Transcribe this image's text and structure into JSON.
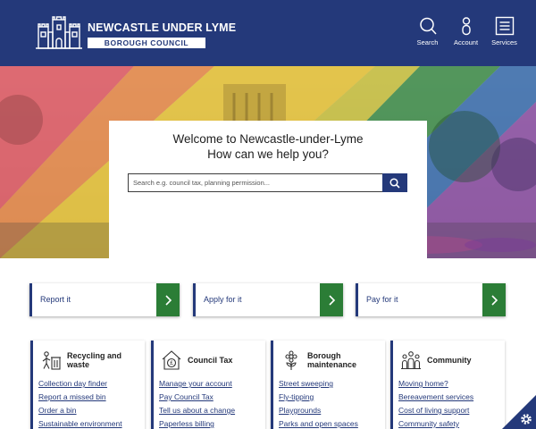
{
  "header": {
    "logo_title": "NEWCASTLE UNDER LYME",
    "logo_subtitle": "BOROUGH COUNCIL",
    "nav": [
      {
        "label": "Search",
        "icon": "search-icon"
      },
      {
        "label": "Account",
        "icon": "user-icon"
      },
      {
        "label": "Services",
        "icon": "menu-icon"
      }
    ],
    "brand_color": "#24397a"
  },
  "hero": {
    "welcome_line1": "Welcome to Newcastle-under-Lyme",
    "welcome_line2": "How can we help you?",
    "search_placeholder": "Search e.g. council tax, planning permission..."
  },
  "quick_actions": [
    {
      "label": "Report it"
    },
    {
      "label": "Apply for it"
    },
    {
      "label": "Pay for it"
    }
  ],
  "services": [
    {
      "title_line1": "Recycling and",
      "title_line2": "waste",
      "icon": "recycling-icon",
      "links": [
        "Collection day finder",
        "Report a missed bin",
        "Order a bin",
        "Sustainable environment"
      ]
    },
    {
      "title_line1": "Council Tax",
      "title_line2": "",
      "icon": "council-tax-icon",
      "links": [
        "Manage your account",
        "Pay Council Tax",
        "Tell us about a change",
        "Paperless billing"
      ]
    },
    {
      "title_line1": "Borough",
      "title_line2": "maintenance",
      "icon": "flower-icon",
      "links": [
        "Street sweeping",
        "Fly-tipping",
        "Playgrounds",
        "Parks and open spaces"
      ]
    },
    {
      "title_line1": "Community",
      "title_line2": "",
      "icon": "community-icon",
      "links": [
        "Moving home?",
        "Bereavement services",
        "Cost of living support",
        "Community safety"
      ]
    }
  ],
  "colors": {
    "accent_green": "#2b7d36",
    "link": "#24397a"
  }
}
